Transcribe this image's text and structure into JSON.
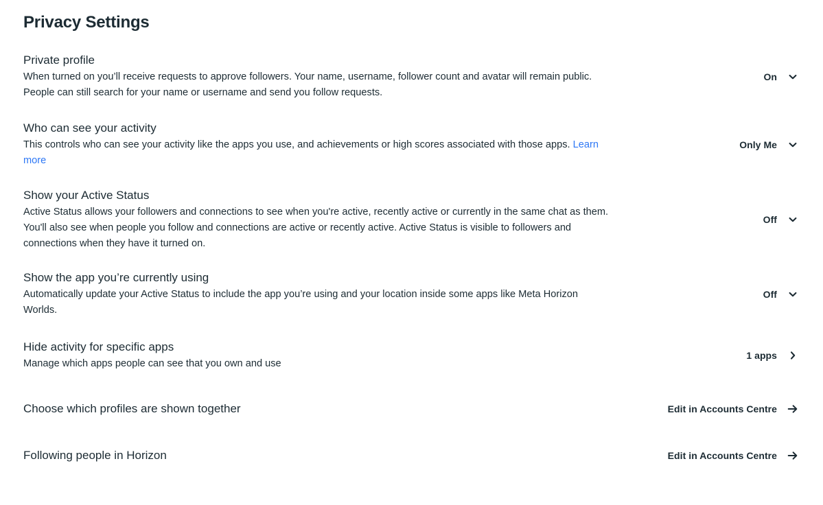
{
  "page": {
    "title": "Privacy Settings",
    "accent_link_color": "#2d77f5",
    "text_color": "#1c2b33",
    "background_color": "#ffffff"
  },
  "settings": [
    {
      "id": "private-profile",
      "title": "Private profile",
      "description": "When turned on you’ll receive requests to approve followers. Your name, username, follower count and avatar will remain public. People can still search for your name or username and send you follow requests.",
      "control_type": "dropdown",
      "control_value": "On",
      "control_icon": "chevron-down-icon"
    },
    {
      "id": "who-can-see-your-activity",
      "title": "Who can see your activity",
      "description": "This controls who can see your activity like the apps you use, and achievements or high scores associated with those apps. ",
      "link_text": "Learn more",
      "control_type": "dropdown",
      "control_value": "Only Me",
      "control_icon": "chevron-down-icon"
    },
    {
      "id": "show-your-active-status",
      "title": "Show your Active Status",
      "description": "Active Status allows your followers and connections to see when you're active, recently active or currently in the same chat as them. You'll also see when people you follow and connections are active or recently active. Active Status is visible to followers and connections when they have it turned on.",
      "control_type": "dropdown",
      "control_value": "Off",
      "control_icon": "chevron-down-icon"
    },
    {
      "id": "show-the-app-youre-currently-using",
      "title": "Show the app you’re currently using",
      "description": "Automatically update your Active Status to include the app you’re using and your location inside some apps like Meta Horizon Worlds.",
      "control_type": "dropdown",
      "control_value": "Off",
      "control_icon": "chevron-down-icon"
    },
    {
      "id": "hide-activity-for-specific-apps",
      "title": "Hide activity for specific apps",
      "description": "Manage which apps people can see that you own and use",
      "control_type": "navigate",
      "control_value": "1 apps",
      "control_icon": "chevron-right-icon"
    },
    {
      "id": "choose-which-profiles-are-shown-together",
      "title": "Choose which profiles are shown together",
      "description": "",
      "control_type": "external",
      "control_value": "Edit in Accounts Centre",
      "control_icon": "arrow-right-icon"
    },
    {
      "id": "following-people-in-horizon",
      "title": "Following people in Horizon",
      "description": "",
      "control_type": "external",
      "control_value": "Edit in Accounts Centre",
      "control_icon": "arrow-right-icon"
    }
  ]
}
